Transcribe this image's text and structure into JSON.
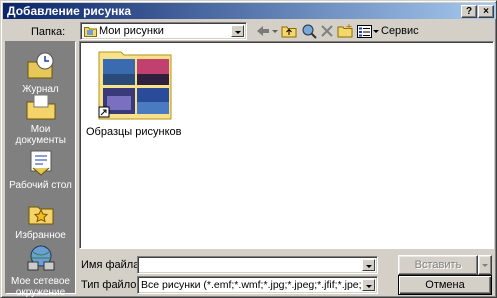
{
  "window": {
    "title": "Добавление рисунка"
  },
  "titlebar_buttons": {
    "help": "?",
    "close": "×"
  },
  "lookin": {
    "label": "Папка:",
    "value": "Мои рисунки"
  },
  "toolbar": {
    "tools_label": "Сервис"
  },
  "places": [
    {
      "label": "Журнал",
      "icon": "history-icon"
    },
    {
      "label": "Мои документы",
      "icon": "my-documents-icon"
    },
    {
      "label": "Рабочий стол",
      "icon": "desktop-icon"
    },
    {
      "label": "Избранное",
      "icon": "favorites-icon"
    },
    {
      "label": "Мое сетевое окружение",
      "icon": "network-places-icon"
    }
  ],
  "files": [
    {
      "name": "Образцы рисунков",
      "icon": "picture-folder-icon"
    }
  ],
  "filename": {
    "label": "Имя файла:",
    "value": ""
  },
  "filetype": {
    "label": "Тип файлов:",
    "value": "Все рисунки (*.emf;*.wmf;*.jpg;*.jpeg;*.jfif;*.jpe;*.png;*."
  },
  "buttons": {
    "insert": "Вставить",
    "cancel": "Отмена"
  },
  "colors": {
    "title_start": "#0a246a",
    "title_end": "#a6caf0",
    "face": "#d4d0c8",
    "places_bg": "#808080"
  }
}
